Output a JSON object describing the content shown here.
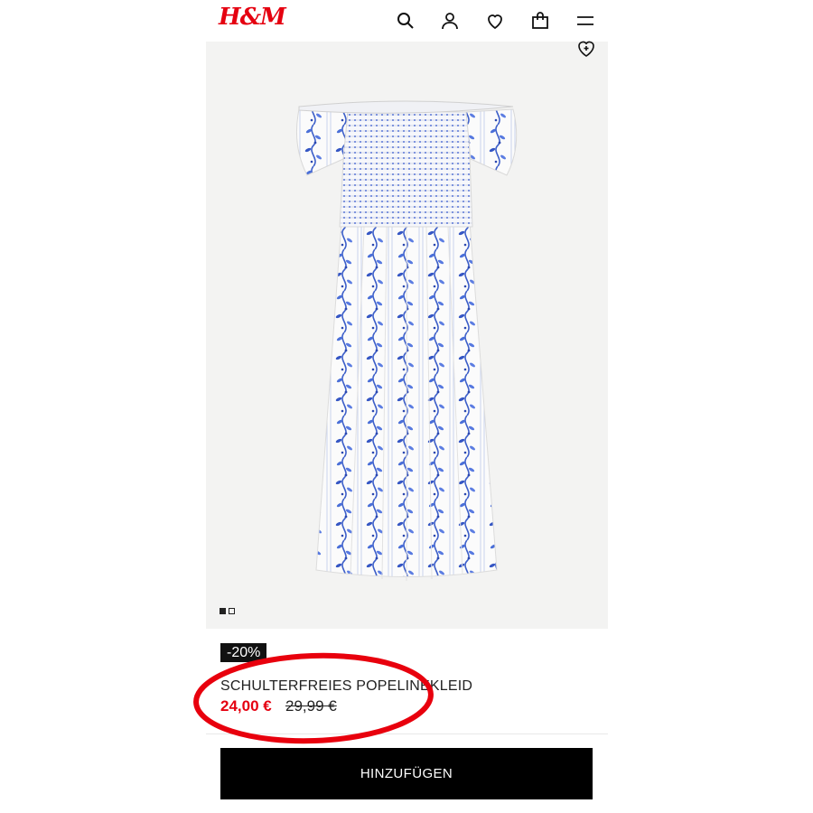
{
  "header": {
    "logo": "H&M",
    "icons": [
      "search-icon",
      "account-icon",
      "favorites-icon",
      "bag-icon",
      "menu-icon"
    ]
  },
  "gallery": {
    "image": "white-blue-floral-off-shoulder-dress",
    "slides_total": 2,
    "slide_active": 1
  },
  "product": {
    "discount_badge": "-20%",
    "name": "SCHULTERFREIES POPELINEKLEID",
    "price": "24,00 €",
    "old_price": "29,99 €"
  },
  "cta": {
    "add_label": "HINZUFÜGEN"
  },
  "colors": {
    "brand": "#e50010",
    "button": "#000000",
    "annotation": "#e8000d"
  }
}
